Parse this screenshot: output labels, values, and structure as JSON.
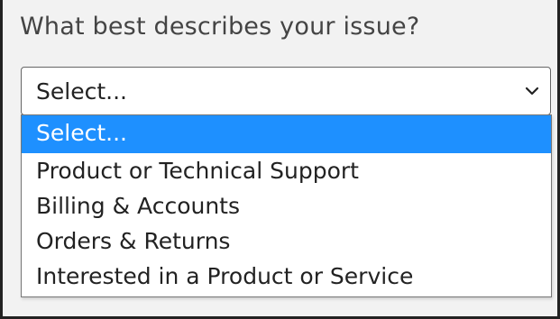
{
  "question": {
    "label": "What best describes your issue?"
  },
  "select": {
    "value": "Select..."
  },
  "dropdown": {
    "options": [
      "Select...",
      "Product or Technical Support",
      "Billing & Accounts",
      "Orders & Returns",
      "Interested in a Product or Service"
    ]
  },
  "colors": {
    "highlight": "#1e90ff"
  },
  "icons": {
    "select_arrow": "chevron-down-icon"
  }
}
